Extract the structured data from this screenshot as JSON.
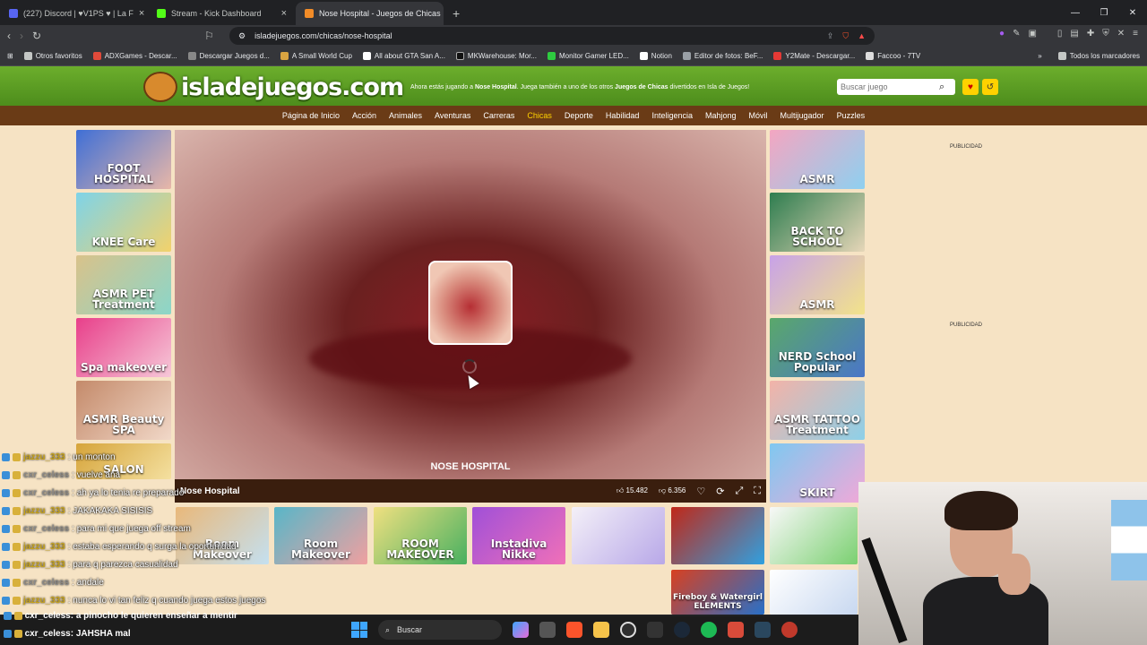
{
  "browser": {
    "tabs": [
      {
        "label": "(227) Discord | ♥V1PS ♥ | La F",
        "color": "#5865f2"
      },
      {
        "label": "Stream - Kick Dashboard",
        "color": "#53fc18"
      },
      {
        "label": "Nose Hospital - Juegos de Chicas",
        "color": "#f28c28",
        "active": true
      }
    ],
    "url": "isladejuegos.com/chicas/nose-hospital",
    "bookmarks": [
      "Otros favoritos",
      "ADXGames - Descar...",
      "Descargar Juegos d...",
      "A Small World Cup",
      "All about GTA San A...",
      "MKWarehouse: Mor...",
      "Monitor Gamer LED...",
      "Notion",
      "Editor de fotos: BeF...",
      "Y2Mate - Descargar...",
      "Faccoo - 7TV"
    ],
    "bookmarks_right": "Todos los marcadores"
  },
  "site": {
    "logo": "isladejuegos.com",
    "header_msg_prefix": "Ahora estás jugando a ",
    "header_msg_game": "Nose Hospital",
    "header_msg_mid": ". Juega también a uno de los otros ",
    "header_msg_cat": "Juegos de Chicas",
    "header_msg_suffix": " divertidos en Isla de Juegos!",
    "search_placeholder": "Buscar juego",
    "nav": [
      "Página de Inicio",
      "Acción",
      "Animales",
      "Aventuras",
      "Carreras",
      "Chicas",
      "Deporte",
      "Habilidad",
      "Inteligencia",
      "Mahjong",
      "Móvil",
      "Multijugador",
      "Puzzles"
    ],
    "nav_active": "Chicas",
    "left_thumbs": [
      "FOOT HOSPITAL",
      "KNEE Care",
      "ASMR PET Treatment",
      "Spa makeover",
      "ASMR Beauty SPA",
      "SALON"
    ],
    "right_thumbs": [
      "ASMR",
      "BACK TO SCHOOL",
      "ASMR",
      "NERD School Popular",
      "ASMR TATTOO Treatment",
      "SKIRT"
    ],
    "bottom_thumbs": [
      "Room Makeover",
      "Room Makeover",
      "ROOM MAKEOVER",
      "Instadiva Nikke",
      "",
      "",
      ""
    ],
    "game_title_overlay": "NOSE HOSPITAL",
    "game_bar_title": "Nose Hospital",
    "likes": "15.482",
    "dislikes": "6.356",
    "ad_label": "PUBLICIDAD",
    "fireboy_label": "Fireboy & Watergirl ELEMENTS"
  },
  "chat": [
    {
      "user": "jazzu_333",
      "msg": ": un monton",
      "color": "#c6a21a"
    },
    {
      "user": "cxr_celess",
      "msg": ": vuelve ana",
      "color": "#8a8a8a"
    },
    {
      "user": "cxr_celess",
      "msg": ": ah ya lo tenia re preparado",
      "color": "#8a8a8a"
    },
    {
      "user": "jazzu_333",
      "msg": ": JAKAKAKA SISISIS",
      "color": "#c6a21a"
    },
    {
      "user": "cxr_celess",
      "msg": ": para mi que juega off stream",
      "color": "#8a8a8a"
    },
    {
      "user": "jazzu_333",
      "msg": ": estaba esperando q surga la oportunidad",
      "color": "#c6a21a"
    },
    {
      "user": "jazzu_333",
      "msg": ": para q parezca casualidad",
      "color": "#c6a21a"
    },
    {
      "user": "cxr_celess",
      "msg": ": andale",
      "color": "#8a8a8a"
    },
    {
      "user": "jazzu_333",
      "msg": ": nunca lo vi tan feliz q cuando juega estos juegos",
      "color": "#c6a21a"
    },
    {
      "user": "cxr_celess",
      "msg": ": a pinocho le quieren enseñar a mentir",
      "color": "#8a8a8a"
    }
  ],
  "chat_last": {
    "user": "cxr_celess",
    "msg": ": JAHSHA mal"
  },
  "taskbar": {
    "search": "Buscar"
  }
}
